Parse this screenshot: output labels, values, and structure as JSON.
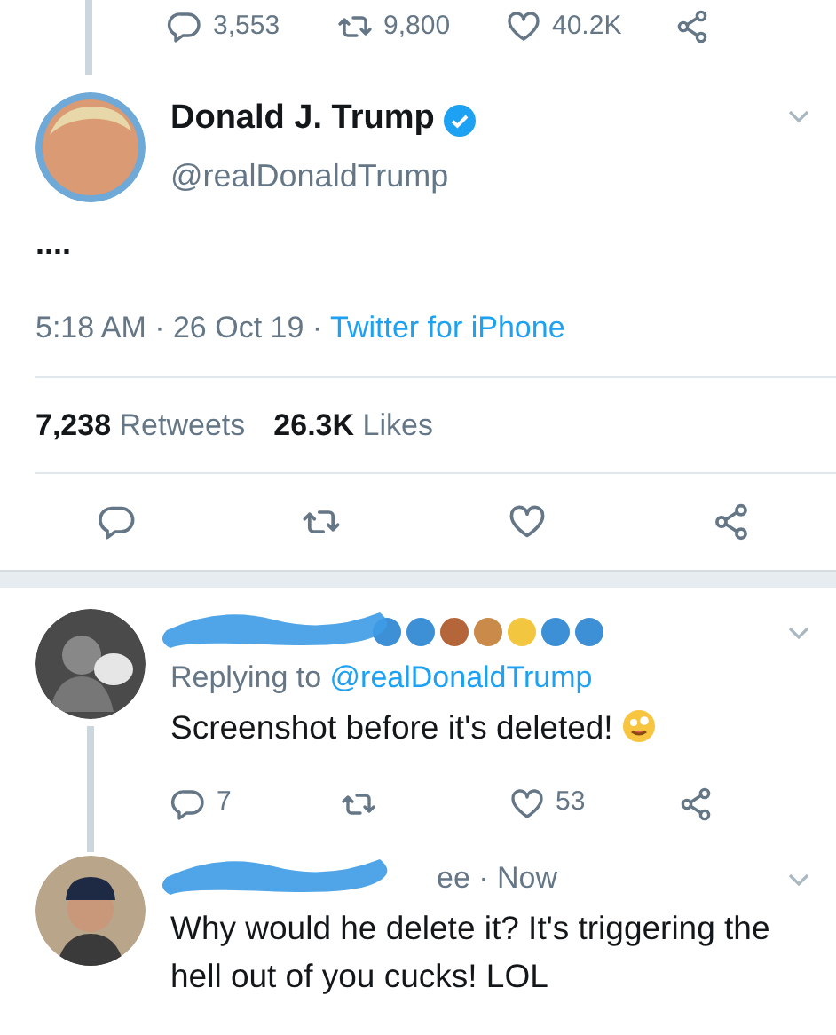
{
  "top_actions": {
    "replies": "3,553",
    "retweets": "9,800",
    "likes": "40.2K"
  },
  "tweet": {
    "name": "Donald J. Trump",
    "verified": true,
    "handle": "@realDonaldTrump",
    "text": "....",
    "time": "5:18 AM · 26 Oct 19 · ",
    "source": "Twitter for iPhone",
    "retweet_count": "7,238",
    "retweet_label": "Retweets",
    "like_count": "26.3K",
    "like_label": "Likes"
  },
  "replies": [
    {
      "redacted": true,
      "kind": "name-emoji",
      "replying_label": "Replying to",
      "replying_to": "@realDonaldTrump",
      "text": "Screenshot before it's deleted!",
      "emoji": true,
      "reply_count": "7",
      "like_count": "53"
    },
    {
      "redacted": true,
      "kind": "name-time",
      "header_tail": "ee · Now",
      "text": "Why would he delete it? It's triggering the hell out of you cucks! LOL"
    }
  ]
}
